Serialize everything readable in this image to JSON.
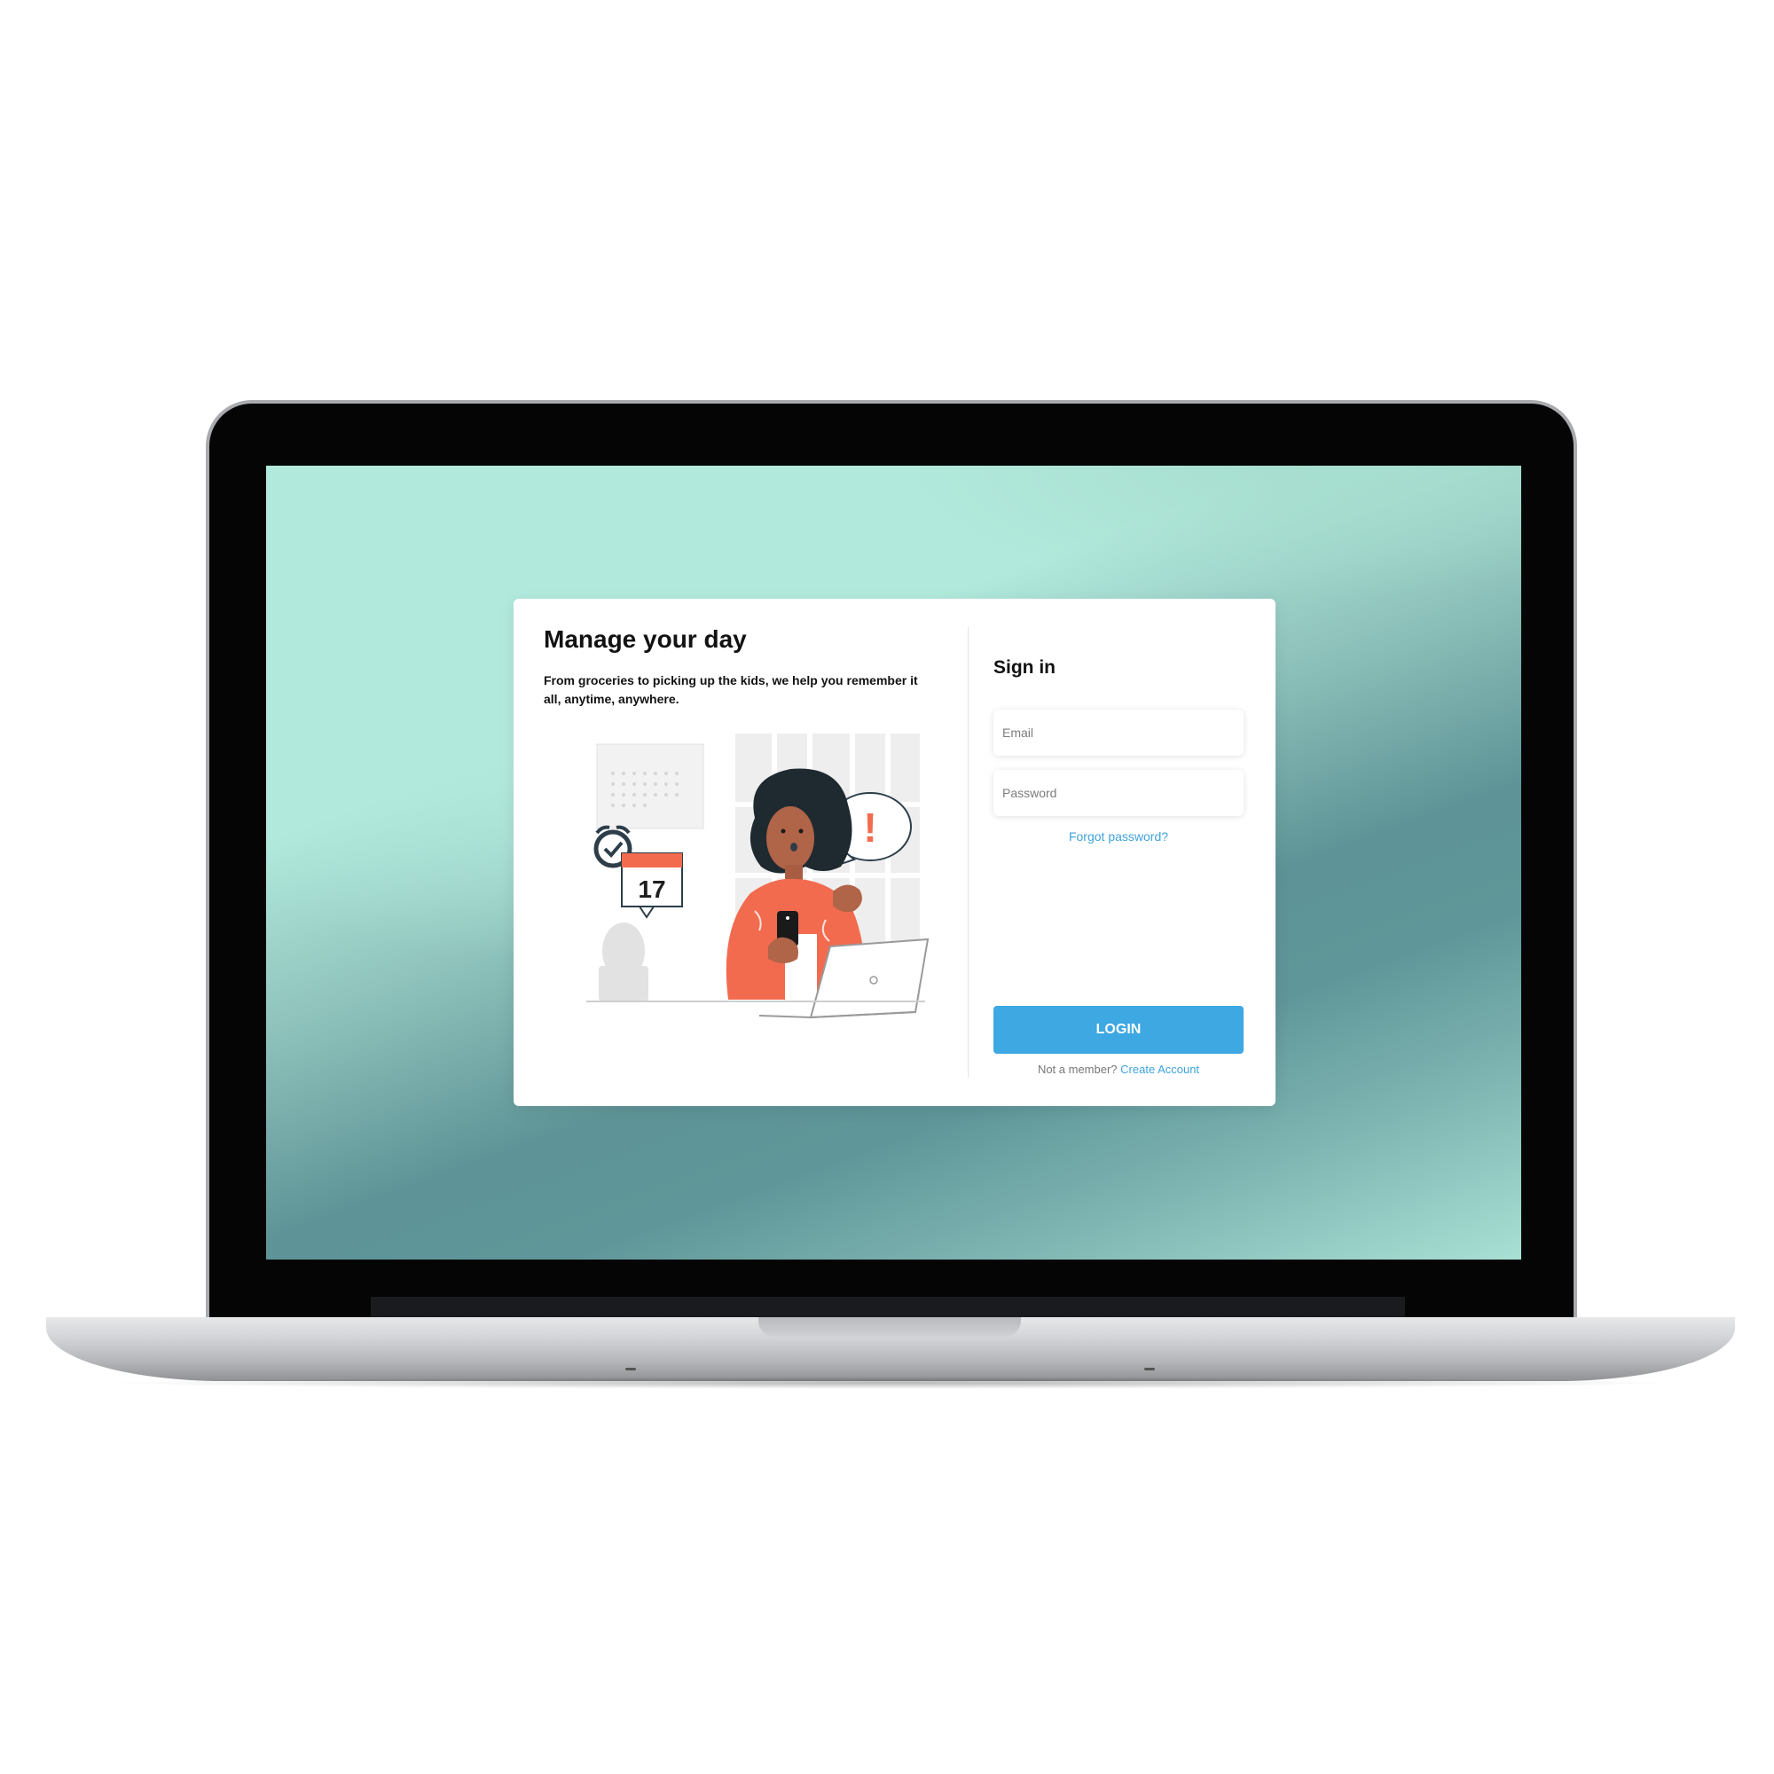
{
  "left_panel": {
    "title": "Manage your day",
    "subtitle": "From groceries to picking up the kids, we help you remember it all, anytime, anywhere.",
    "illustration": {
      "calendar_day": "17",
      "alert_symbol": "!"
    }
  },
  "signin": {
    "title": "Sign in",
    "email_placeholder": "Email",
    "password_placeholder": "Password",
    "forgot_password": "Forgot password?",
    "login_label": "LOGIN",
    "not_member_text": "Not a member?",
    "create_account": "Create Account"
  },
  "colors": {
    "accent": "#3ea8e2",
    "illustration_orange": "#f26b4f",
    "background_teal": "#5f9699",
    "background_mint": "#b1e9dc"
  }
}
